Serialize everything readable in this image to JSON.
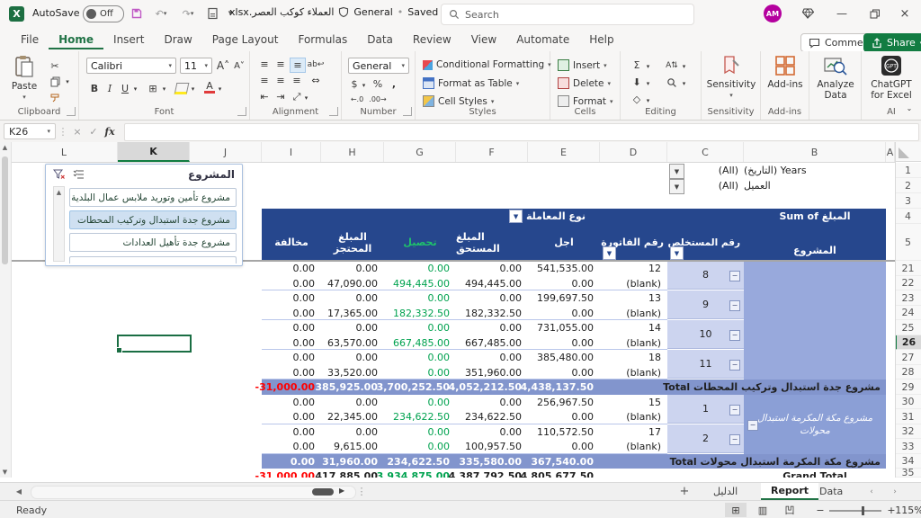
{
  "titlebar": {
    "autosave_label": "AutoSave",
    "autosave_state": "Off",
    "filename": "العملاء كوكب العصر.xlsx",
    "sensitivity_badge": "General",
    "save_status": "Saved to this PC",
    "search_placeholder": "Search",
    "avatar_initials": "AM"
  },
  "ribbon_tabs": {
    "items": [
      "File",
      "Home",
      "Insert",
      "Draw",
      "Page Layout",
      "Formulas",
      "Data",
      "Review",
      "View",
      "Automate",
      "Help"
    ],
    "active": "Home",
    "comments_label": "Comments",
    "share_label": "Share"
  },
  "ribbon": {
    "paste_label": "Paste",
    "font_name": "Calibri",
    "font_size": "11",
    "bold": "B",
    "italic": "I",
    "underline": "U",
    "number_format": "General",
    "styles_items": {
      "conditional": "Conditional Formatting",
      "format_table": "Format as Table",
      "cell_styles": "Cell Styles"
    },
    "cells_items": {
      "insert": "Insert",
      "delete": "Delete",
      "format": "Format"
    },
    "sensitivity_label": "Sensitivity",
    "addins_label": "Add-ins",
    "analyze_label": "Analyze Data",
    "chatgpt_label": "ChatGPT for Excel",
    "group_labels": {
      "clipboard": "Clipboard",
      "font": "Font",
      "alignment": "Alignment",
      "number": "Number",
      "styles": "Styles",
      "cells": "Cells",
      "editing": "Editing",
      "sensitivity": "Sensitivity",
      "addins": "Add-ins",
      "ai": "AI"
    }
  },
  "formula_bar": {
    "name_box": "K26",
    "fx": "fx",
    "formula_value": ""
  },
  "grid": {
    "columns": [
      "L",
      "K",
      "J",
      "I",
      "H",
      "G",
      "F",
      "E",
      "D",
      "C",
      "B",
      "A"
    ],
    "rows_top": [
      "1",
      "2",
      "3",
      "4",
      "5"
    ],
    "rows_bottom": [
      "21",
      "22",
      "23",
      "24",
      "25",
      "26",
      "27",
      "28",
      "29",
      "30",
      "31",
      "32",
      "33",
      "34",
      "35"
    ],
    "selected_cell": "K26"
  },
  "filters": [
    {
      "label": "Years (التاريخ)",
      "value": "(All)"
    },
    {
      "label": "العميل",
      "value": "(All)"
    }
  ],
  "slicer": {
    "title": "المشروع",
    "items": [
      {
        "label": "مشروع تأمين وتوريد ملابس عمال البلدية",
        "selected": false
      },
      {
        "label": "مشروع جدة استبدال وتركيب المحطات",
        "selected": true
      },
      {
        "label": "مشروع جدة تأهيل العدادات",
        "selected": false
      }
    ]
  },
  "pivot": {
    "sum_of": "Sum of المبلغ",
    "row_field": "المشروع",
    "filter_field": "نوع المعاملة",
    "headers": {
      "i": "مخالفة",
      "h": "المبلغ المحتجز",
      "g": "تحصيل",
      "f": "المبلغ المستحق",
      "e": "اجل",
      "d": "رقم الفاتورة",
      "c": "رقم المستخلص"
    },
    "c_groups": [
      {
        "label": "8",
        "s": 0,
        "e": 1
      },
      {
        "label": "9",
        "s": 2,
        "e": 3
      },
      {
        "label": "10",
        "s": 4,
        "e": 5
      },
      {
        "label": "11",
        "s": 6,
        "e": 7
      },
      {
        "label": "1",
        "s": 9,
        "e": 10
      },
      {
        "label": "2",
        "s": 11,
        "e": 12
      }
    ],
    "b_groups": [
      {
        "label": "",
        "s": 0,
        "e": 7
      },
      {
        "label": "مشروع مكة المكرمة استبدال محولات",
        "s": 9,
        "e": 12
      }
    ],
    "rows": [
      {
        "t": "d",
        "i": "0.00",
        "h": "0.00",
        "g": "0.00",
        "f": "0.00",
        "e": "541,535.00",
        "d": "12"
      },
      {
        "t": "d",
        "i": "0.00",
        "h": "47,090.00",
        "g": "494,445.00",
        "f": "494,445.00",
        "e": "0.00",
        "d": "(blank)"
      },
      {
        "t": "d",
        "i": "0.00",
        "h": "0.00",
        "g": "0.00",
        "f": "0.00",
        "e": "199,697.50",
        "d": "13"
      },
      {
        "t": "d",
        "i": "0.00",
        "h": "17,365.00",
        "g": "182,332.50",
        "f": "182,332.50",
        "e": "0.00",
        "d": "(blank)"
      },
      {
        "t": "d",
        "i": "0.00",
        "h": "0.00",
        "g": "0.00",
        "f": "0.00",
        "e": "731,055.00",
        "d": "14"
      },
      {
        "t": "d",
        "i": "0.00",
        "h": "63,570.00",
        "g": "667,485.00",
        "f": "667,485.00",
        "e": "0.00",
        "d": "(blank)"
      },
      {
        "t": "d",
        "i": "0.00",
        "h": "0.00",
        "g": "0.00",
        "f": "0.00",
        "e": "385,480.00",
        "d": "18"
      },
      {
        "t": "d",
        "i": "0.00",
        "h": "33,520.00",
        "g": "0.00",
        "f": "351,960.00",
        "e": "0.00",
        "d": "(blank)"
      },
      {
        "t": "t",
        "label": "مشروع جدة استبدال وتركيب المحطات Total",
        "i": "-31,000.00",
        "h": "385,925.00",
        "g": "3,700,252.50",
        "f": "4,052,212.50",
        "e": "4,438,137.50"
      },
      {
        "t": "d",
        "i": "0.00",
        "h": "0.00",
        "g": "0.00",
        "f": "0.00",
        "e": "256,967.50",
        "d": "15"
      },
      {
        "t": "d",
        "i": "0.00",
        "h": "22,345.00",
        "g": "234,622.50",
        "f": "234,622.50",
        "e": "0.00",
        "d": "(blank)"
      },
      {
        "t": "d",
        "i": "0.00",
        "h": "0.00",
        "g": "0.00",
        "f": "0.00",
        "e": "110,572.50",
        "d": "17"
      },
      {
        "t": "d",
        "i": "0.00",
        "h": "9,615.00",
        "g": "0.00",
        "f": "100,957.50",
        "e": "0.00",
        "d": "(blank)"
      },
      {
        "t": "t",
        "label": "مشروع مكة المكرمة استبدال محولات Total",
        "i": "0.00",
        "h": "31,960.00",
        "g": "234,622.50",
        "f": "335,580.00",
        "e": "367,540.00"
      },
      {
        "t": "g",
        "label": "Grand Total",
        "i": "-31,000.00",
        "h": "417,885.00",
        "g": "3,934,875.00",
        "f": "4,387,792.50",
        "e": "4,805,677.50"
      }
    ]
  },
  "sheet_bar": {
    "add": "+",
    "tabs": [
      "الدليل",
      "Report",
      "Data"
    ],
    "active": "Report"
  },
  "status_bar": {
    "ready": "Ready",
    "zoom": "115%"
  }
}
